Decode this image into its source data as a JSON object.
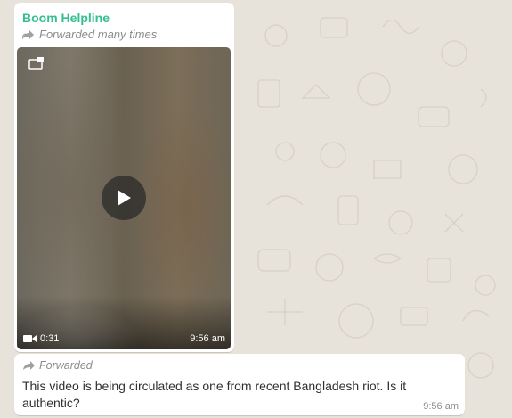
{
  "colors": {
    "wallpaper": "#e7e2da",
    "bubble": "#ffffff",
    "sender_name": "#35bf8f",
    "meta_text": "#8c8c8c"
  },
  "video_message": {
    "sender": "Boom Helpline",
    "forwarded_label": "Forwarded many times",
    "forward_icon": "double-forward-arrow-icon",
    "duration": "0:31",
    "time": "9:56 am",
    "icons": [
      "play-icon",
      "picture-in-picture-icon",
      "video-camera-icon"
    ]
  },
  "text_message": {
    "forwarded_label": "Forwarded",
    "forward_icon": "forward-arrow-icon",
    "text": "This video is being circulated as one from recent Bangladesh riot. Is it authentic?",
    "time": "9:56 am"
  }
}
